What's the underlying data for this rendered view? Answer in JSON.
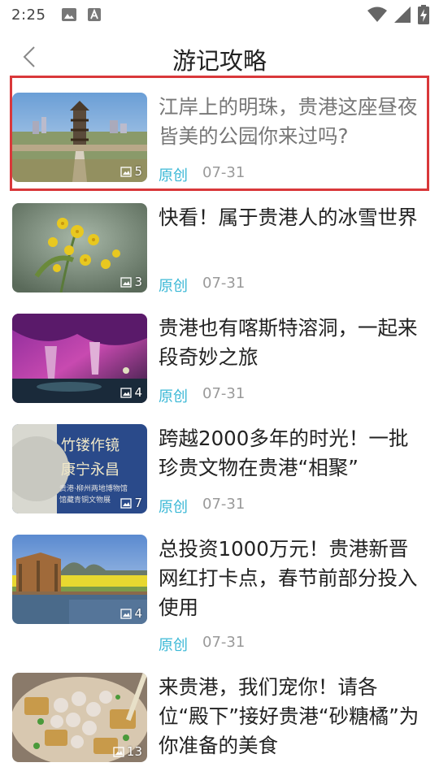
{
  "status": {
    "time": "2:25"
  },
  "header": {
    "title": "游记攻略"
  },
  "articles": [
    {
      "title": "江岸上的明珠，贵港这座昼夜皆美的公园你来过吗?",
      "tag": "原创",
      "date": "07-31",
      "image_count": "5"
    },
    {
      "title": "快看！属于贵港人的冰雪世界",
      "tag": "原创",
      "date": "07-31",
      "image_count": "3"
    },
    {
      "title": "贵港也有喀斯特溶洞，一起来段奇妙之旅",
      "tag": "原创",
      "date": "07-31",
      "image_count": "4"
    },
    {
      "title": "跨越2000多年的时光！一批珍贵文物在贵港“相聚”",
      "tag": "原创",
      "date": "07-31",
      "image_count": "7",
      "image_caption_1": "竹镂作镜",
      "image_caption_2": "康宁永昌",
      "image_caption_3": "贵港·柳州两地博物馆",
      "image_caption_4": "馆藏青铜文物展"
    },
    {
      "title": "总投资1000万元！贵港新晋网红打卡点，春节前部分投入使用",
      "tag": "原创",
      "date": "07-31",
      "image_count": "4"
    },
    {
      "title": "来贵港，我们宠你！请各位“殿下”接好贵港“砂糖橘”为你准备的美食",
      "tag": "原创",
      "date": "07-31",
      "image_count": "13"
    }
  ],
  "colors": {
    "accent": "#3bb8d6",
    "highlight_border": "#d9383a",
    "date_gray": "#9a9a9a"
  },
  "icons": {
    "back": "chevron-left-icon",
    "wifi": "wifi-icon",
    "signal": "signal-icon",
    "battery": "battery-charging-icon",
    "gallery": "image-gallery-icon"
  }
}
